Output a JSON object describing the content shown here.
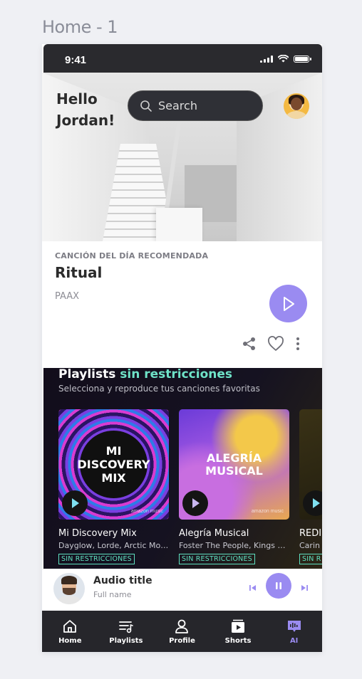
{
  "frame_title": "Home - 1",
  "status": {
    "time": "9:41"
  },
  "header": {
    "greeting_line1": "Hello",
    "greeting_line2": "Jordan!",
    "search_placeholder": "Search"
  },
  "song_of_day": {
    "label": "CANCIÓN DEL DÍA RECOMENDADA",
    "title": "Ritual",
    "artist": "PAAX"
  },
  "playlists": {
    "title_plain": "Playlists",
    "title_highlight": "sin restricciones",
    "subtitle": "Selecciona y reproduce tus canciones favoritas",
    "highlight_color": "#6fe3c8",
    "items": [
      {
        "cover_text_1": "MI",
        "cover_text_2": "DISCOVERY",
        "cover_text_3": "MIX",
        "name": "Mi Discovery Mix",
        "artists": "Dayglow, Lorde, Arctic Monkeys",
        "badge": "SIN RESTRICCIONES",
        "brand": "amazon music"
      },
      {
        "cover_text_1": "ALEGRÍA",
        "cover_text_2": "MUSICAL",
        "name": "Alegría Musical",
        "artists": "Foster The People, Kings of Leon",
        "badge": "SIN RESTRICCIONES",
        "brand": "amazon music"
      },
      {
        "name": "REDI",
        "artists": "Carin",
        "badge": "SIN R"
      }
    ]
  },
  "player": {
    "title": "Audio title",
    "subtitle": "Full name"
  },
  "nav": {
    "items": [
      {
        "label": "Home",
        "icon": "home-icon"
      },
      {
        "label": "Playlists",
        "icon": "playlist-icon"
      },
      {
        "label": "Profile",
        "icon": "profile-icon"
      },
      {
        "label": "Shorts",
        "icon": "shorts-icon"
      },
      {
        "label": "AI",
        "icon": "ai-icon"
      }
    ],
    "active": "AI"
  },
  "colors": {
    "accent": "#9a8bf1",
    "dark": "#26262b"
  }
}
